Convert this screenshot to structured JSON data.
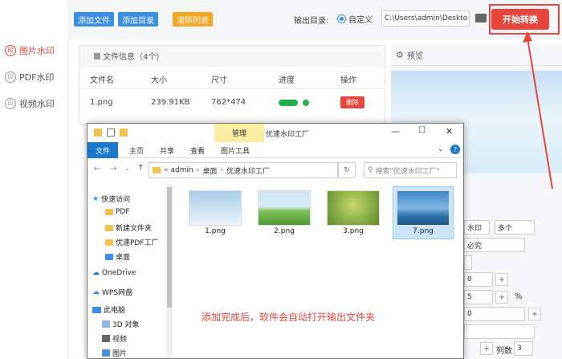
{
  "nav": {
    "items": [
      {
        "label": "图片水印",
        "active": true
      },
      {
        "label": "PDF水印",
        "active": false
      },
      {
        "label": "视频水印",
        "active": false
      }
    ]
  },
  "toolbar": {
    "add_file": "添加文件",
    "add_dir": "添加目录",
    "clear_list": "清除列表",
    "output_label": "输出目录:",
    "custom_label": "自定义",
    "output_path": "C:\\Users\\admin\\Deskto",
    "start_label": "开始转换"
  },
  "fileinfo": {
    "header": "文件信息（4个）",
    "columns": [
      "文件名",
      "大小",
      "尺寸",
      "进度",
      "操作"
    ],
    "row": {
      "name": "1.png",
      "size": "239.91KB",
      "dims": "762*474",
      "delete": "删除"
    }
  },
  "preview": {
    "title": "预览",
    "f1": "水印",
    "f2": "多个",
    "f3": "必究",
    "percent": "%",
    "cols_label": "列数",
    "cols_value": "3",
    "val_5": "5",
    "val_0": "0"
  },
  "explorer": {
    "manage_tab": "管理",
    "title": "优速水印工厂",
    "tabs": [
      "文件",
      "主页",
      "共享",
      "查看",
      "图片工具"
    ],
    "breadcrumb": [
      "admin",
      "桌面",
      "优速水印工厂"
    ],
    "search_placeholder": "搜索\"优速水印工厂\"",
    "tree": {
      "quick_access": "快速访问",
      "pdf": "PDF",
      "new_folder": "新建文件夹",
      "yousu_pdf": "优速PDF工厂",
      "desktop": "桌面",
      "onedrive": "OneDrive",
      "wps": "WPS网盘",
      "this_pc": "此电脑",
      "objects3d": "3D 对象",
      "videos": "视频",
      "pictures": "图片"
    },
    "files": [
      "1.png",
      "2.png",
      "3.png",
      "7.png"
    ]
  },
  "note": "添加完成后，软件会自动打开输出文件夹",
  "colors": {
    "accent": "#e8453c",
    "blue": "#3a8ee6",
    "orange": "#f5a623"
  }
}
